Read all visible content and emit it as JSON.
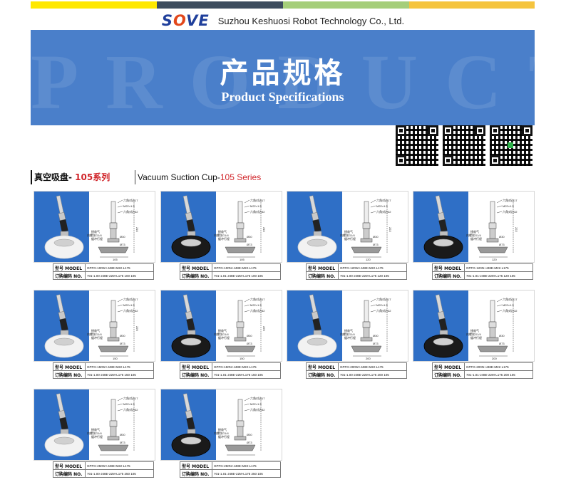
{
  "topbar": {
    "colors": [
      "#ffe800",
      "#3d4c5e",
      "#a5ce7a",
      "#f5c43e"
    ]
  },
  "header": {
    "logo": {
      "part1": "S",
      "part2": "O",
      "part3": "VE"
    },
    "company": "Suzhou Keshuosi Robot Technology Co., Ltd."
  },
  "banner": {
    "watermark": "PRODUCT",
    "title": "产品规格",
    "subtitle": "Product Specifications",
    "color": "#4a7fca"
  },
  "series": {
    "cn_prefix": "真空吸盘- ",
    "cn_highlight": "105系列",
    "en_prefix": "Vacuum Suction Cup-",
    "en_highlight": "105 Series",
    "accent": "#d1262b"
  },
  "drawing_labels": {
    "hex17": "六角对边17",
    "thread": "M22×1.5",
    "hex32": "六角对边32",
    "vac": "接吸气",
    "inner": "内螺纹G1/4",
    "bumper": "缓冲行程",
    "d30": "Ø30",
    "d73": "Ø73"
  },
  "cards": [
    {
      "cup": "white",
      "width_label": "105",
      "height_label": "210",
      "model_key": "型号 MODEL",
      "model": "GPFG-100W+J48E-M22-L175",
      "no_key": "订购编码 NO.",
      "no": "701-1.00-J48E-22M-L175 100 105"
    },
    {
      "cup": "black",
      "width_label": "105",
      "height_label": "210",
      "model_key": "型号 MODEL",
      "model": "GPFG-100N+J48E-M22-L175",
      "no_key": "订购编码 NO.",
      "no": "701-1.01-J48E-22M-L175 100 105"
    },
    {
      "cup": "white",
      "width_label": "120",
      "height_label": "222",
      "model_key": "型号 MODEL",
      "model": "GPFG-120W+J48E-M22-L175",
      "no_key": "订购编码 NO.",
      "no": "701-1.00-J48E-22M-L175 120 105"
    },
    {
      "cup": "black",
      "width_label": "120",
      "height_label": "222",
      "model_key": "型号 MODEL",
      "model": "GPFG-120N+J48E-M22-L175",
      "no_key": "订购编码 NO.",
      "no": "701-1.01-J48E-22M-L175 120 105"
    },
    {
      "cup": "white",
      "width_label": "150",
      "height_label": "229",
      "model_key": "型号 MODEL",
      "model": "GPFG-150W+J48E-M22-L175",
      "no_key": "订购编码 NO.",
      "no": "701-1.00-J48E-22M-L175 150 105"
    },
    {
      "cup": "black",
      "width_label": "150",
      "height_label": "229",
      "model_key": "型号 MODEL",
      "model": "GPFG-150N+J48E-M22-L175",
      "no_key": "订购编码 NO.",
      "no": "701-1.01-J48E-22M-L175 150 105"
    },
    {
      "cup": "white",
      "width_label": "200",
      "height_label": "",
      "model_key": "型号 MODEL",
      "model": "GPFG-200W+J48E-M22-L175",
      "no_key": "订购编码 NO.",
      "no": "701-1.00-J48E-22M-L175 200 105"
    },
    {
      "cup": "black",
      "width_label": "200",
      "height_label": "",
      "model_key": "型号 MODEL",
      "model": "GPFG-200N+J48E-M22-L175",
      "no_key": "订购编码 NO.",
      "no": "701-1.01-J48E-22M-L175 200 105"
    },
    {
      "cup": "white",
      "width_label": "",
      "height_label": "",
      "model_key": "型号 MODEL",
      "model": "GPFG-250W+J48E-M22-L175",
      "no_key": "订购编码 NO.",
      "no": "701-1.00-J48E-22M-L175 250 105"
    },
    {
      "cup": "black",
      "width_label": "",
      "height_label": "",
      "model_key": "型号 MODEL",
      "model": "GPFG-250N+J48E-M22-L175",
      "no_key": "订购编码 NO.",
      "no": "701-1.01-J48E-22M-L175 250 105"
    }
  ]
}
